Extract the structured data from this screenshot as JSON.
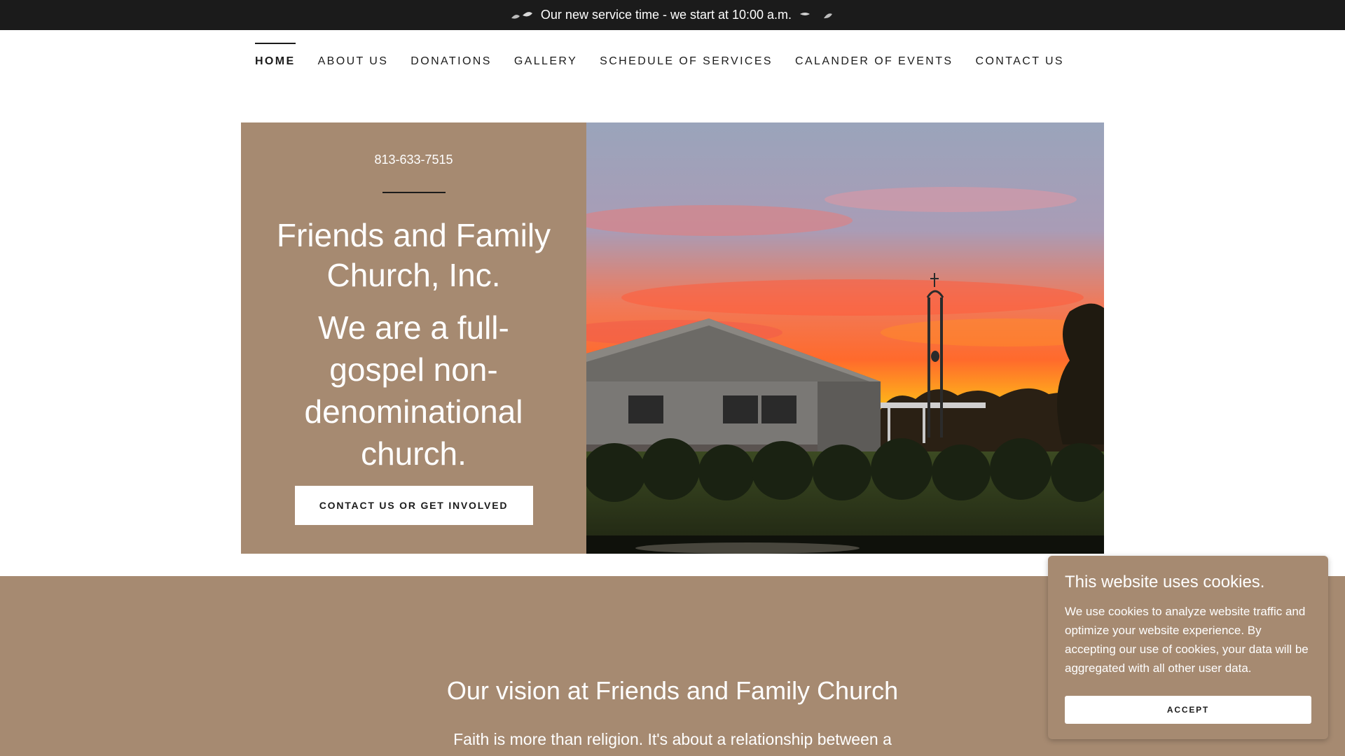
{
  "announcement": {
    "text": "Our new service time - we start at 10:00 a.m.",
    "left_icon": "dove-pair-icon",
    "right_icon": "dove-pair-icon"
  },
  "nav": {
    "items": [
      {
        "label": "HOME",
        "active": true
      },
      {
        "label": "ABOUT US",
        "active": false
      },
      {
        "label": "DONATIONS",
        "active": false
      },
      {
        "label": "GALLERY",
        "active": false
      },
      {
        "label": "SCHEDULE OF SERVICES",
        "active": false
      },
      {
        "label": "CALANDER OF EVENTS",
        "active": false
      },
      {
        "label": "CONTACT US",
        "active": false
      }
    ]
  },
  "hero": {
    "phone": "813-633-7515",
    "title": "Friends and Family Church, Inc.",
    "tagline": "We are a full-gospel non-denominational church.",
    "cta_label": "CONTACT US OR GET INVOLVED",
    "image_subject": "church-building-at-sunset"
  },
  "vision": {
    "heading": "Our vision at Friends and Family Church",
    "body": "Faith is more than religion. It's about a relationship between a"
  },
  "cookie": {
    "title": "This website uses cookies.",
    "body": "We use cookies to analyze website traffic and optimize your website experience. By accepting our use of cookies, your data will be aggregated with all other user data.",
    "accept_label": "ACCEPT"
  },
  "colors": {
    "announcement_bg": "#1b1b1b",
    "brand_tan": "#a68a71",
    "text_dark": "#1b1b1b",
    "white": "#ffffff"
  }
}
